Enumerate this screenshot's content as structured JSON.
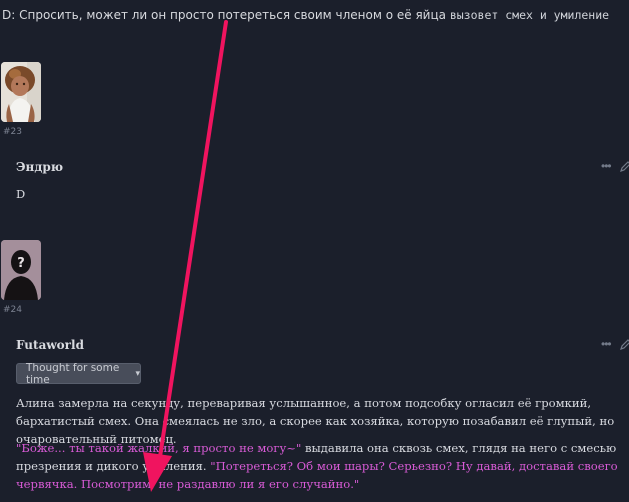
{
  "top_line": {
    "prefix": "D: Спросить, может ли он просто потереться своим членом о её яйца",
    "suffix": "вызовет смех и умиление"
  },
  "posts": [
    {
      "number": "#23",
      "author": "Эндрю",
      "text": "D"
    },
    {
      "number": "#24",
      "author": "Futaworld",
      "thought_button_label": "Thought for some time",
      "paragraph1": "Алина замерла на секунду, переваривая услышанное, а потом подсобку огласил её громкий, бархатистый смех. Она смеялась не зло, а скорее как хозяйка, которую позабавил её глупый, но очаровательный питомец.",
      "paragraph2_speech1": "\"Боже... ты такой жалкий, я просто не могу~\"",
      "paragraph2_narration": " выдавила она сквозь смех, глядя на него с смесью презрения и дикого умиления. ",
      "paragraph2_speech2": "\"Потереться? Об мои шары? Серьезно? Ну давай, доставай своего червячка. Посмотрим, не раздавлю ли я его случайно.\""
    }
  ],
  "colors": {
    "background": "#1b1f2b",
    "speech": "#d85bd6",
    "arrow": "#f0145f"
  },
  "icons": {
    "more": "more-horizontal-icon",
    "edit": "pencil-icon",
    "chevron": "chevron-down-icon"
  }
}
